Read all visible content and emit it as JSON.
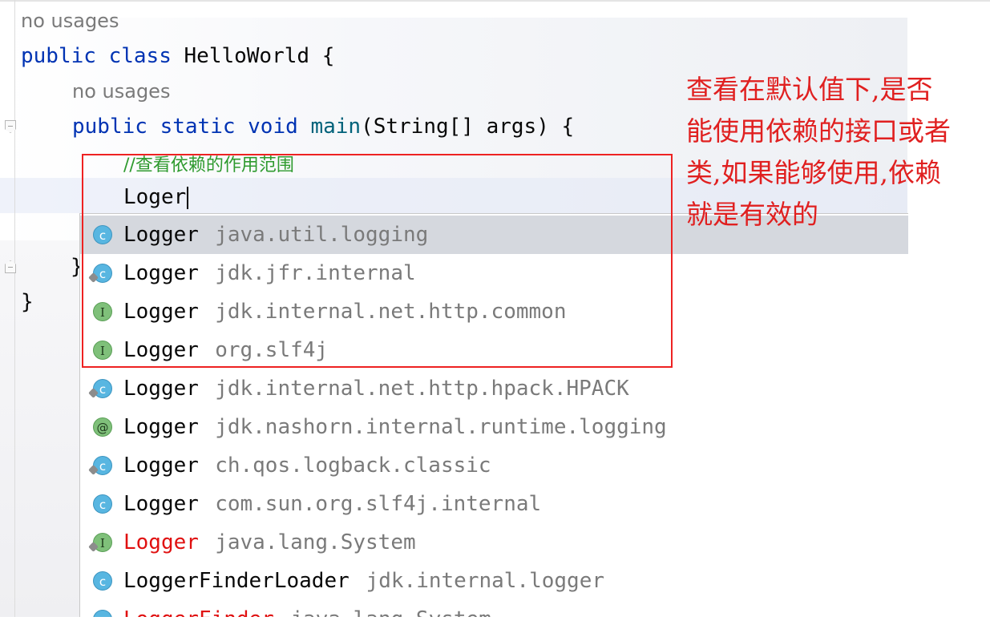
{
  "editor": {
    "hint_top": "no usages",
    "class_line": {
      "kw_public": "public",
      "kw_class": "class",
      "name": "HelloWorld",
      "brace": "{"
    },
    "hint_method": "no usages",
    "method_line": {
      "kw_public": "public",
      "kw_static": "static",
      "kw_void": "void",
      "name": "main",
      "params": "(String[] args) {"
    },
    "comment": "//查看依赖的作用范围",
    "typed_text": "Loger",
    "method_close": "}",
    "class_close": "}"
  },
  "completion": {
    "items": [
      {
        "icon": "class-icon",
        "badge": "c",
        "name": "Logger",
        "pkg": "java.util.logging"
      },
      {
        "icon": "class-icon",
        "badge": "c",
        "name": "Logger",
        "pkg": "jdk.jfr.internal"
      },
      {
        "icon": "interface-icon",
        "badge": "I",
        "name": "Logger",
        "pkg": "jdk.internal.net.http.common"
      },
      {
        "icon": "interface-icon",
        "badge": "I",
        "name": "Logger",
        "pkg": "org.slf4j"
      },
      {
        "icon": "class-icon",
        "badge": "c",
        "name": "Logger",
        "pkg": "jdk.internal.net.http.hpack.HPACK"
      },
      {
        "icon": "annotation-icon",
        "badge": "@",
        "name": "Logger",
        "pkg": "jdk.nashorn.internal.runtime.logging"
      },
      {
        "icon": "class-icon",
        "badge": "c",
        "name": "Logger",
        "pkg": "ch.qos.logback.classic"
      },
      {
        "icon": "class-icon",
        "badge": "c",
        "name": "Logger",
        "pkg": "com.sun.org.slf4j.internal"
      },
      {
        "icon": "interface-icon",
        "badge": "I",
        "name": "Logger",
        "pkg": "java.lang.System"
      },
      {
        "icon": "class-icon",
        "badge": "c",
        "name": "LoggerFinderLoader",
        "pkg": "jdk.internal.logger"
      },
      {
        "icon": "class-icon",
        "badge": "c",
        "name": "LoggerFinder",
        "pkg": "java.lang.System"
      }
    ]
  },
  "annotation_note": "查看在默认值下,是否能使用依赖的接口或者类,如果能够使用,依赖就是有效的",
  "colors": {
    "keyword": "#0033b3",
    "comment": "#2e9a2e",
    "highlight_box": "#ee2222",
    "note_text": "#e02020",
    "deprecated_name": "#e01010"
  }
}
